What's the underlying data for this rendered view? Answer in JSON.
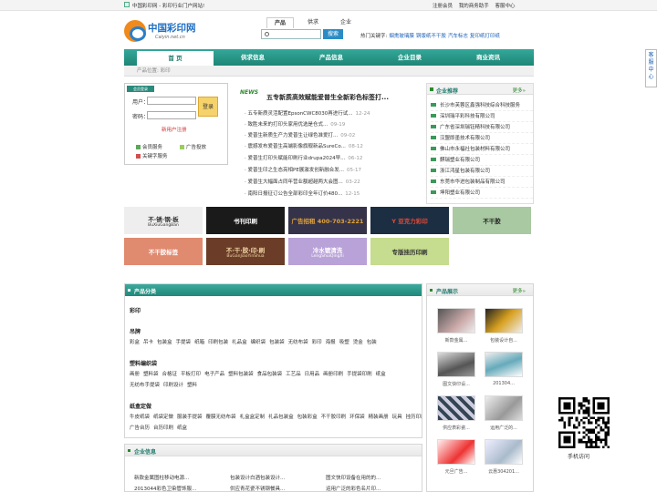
{
  "topbar": {
    "site_text": "中国彩印网 - 彩印行业门户网站!",
    "links": [
      "注册会员",
      "我的商务助手",
      "客服中心"
    ]
  },
  "logo": {
    "cn": "中国彩印网",
    "url": "Caiyin.net.cn"
  },
  "search": {
    "tabs": [
      "产品",
      "供求",
      "企业"
    ],
    "active_tab": "产品",
    "placeholder": "",
    "button": "搜索",
    "hot_label": "热门关键字:",
    "hot_keywords": [
      "烟熏玻璃膜",
      "铜版纸不干胶",
      "汽车标志",
      "复印纸打印纸"
    ]
  },
  "nav": {
    "items": [
      "首 页",
      "供求信息",
      "产品信息",
      "企业目录",
      "商业资讯"
    ],
    "active": "首 页"
  },
  "breadcrumb": "产品位置: 彩印",
  "login": {
    "badge": "会员登录",
    "user_label": "用户：",
    "pass_label": "密码：",
    "login_button": "登录",
    "register": "新用户注册",
    "services": [
      "会员服务",
      "广告投放",
      "关键字服务"
    ]
  },
  "news": {
    "badge": "NEWS",
    "headline": "五专新质高效赋能爱普生全新彩色标签打...",
    "items": [
      {
        "title": "五专新质灵活配置EpsonCWC8030再进行试...",
        "date": "12-24"
      },
      {
        "title": "致胜未来的打印头家用优选是仓式...",
        "date": "09-19"
      },
      {
        "title": "爱普生新质生产力爱普生让绿色准爱打...",
        "date": "09-02"
      },
      {
        "title": "震撼发布爱普生高端影像旗舰新品SureCo...",
        "date": "08-12"
      },
      {
        "title": "爱普生打印头赋能印刷行业drupa2024早...",
        "date": "06-12"
      },
      {
        "title": "爱普生印之生态亮相PE展激发创新融合发...",
        "date": "05-17"
      },
      {
        "title": "爱普生大幅面占同年营业额超越两大会图...",
        "date": "03-22"
      },
      {
        "title": "南阳日报征订公告全部彩印全年订价480...",
        "date": "12-15"
      }
    ]
  },
  "recommend": {
    "title": "企业推荐",
    "more": "更多»",
    "items": [
      "长沙市芙蓉区鑫强科技综合科技服务",
      "深圳瑞平彩科技有限公司",
      "广东省深圳瑞钰精科技有限公司",
      "汉盟即墨技术有限公司",
      "佛山市永福社包装材料有限公司",
      "麒瑞塑业有限公司",
      "浙江鸿星包装有限公司",
      "东莞市华进包装制品有限公司",
      "坤阳塑业有限公司"
    ]
  },
  "ads": [
    {
      "text": "不·锈·钢·板\nBuXiuGangBan",
      "bg": "#eeeeee",
      "fg": "#333333"
    },
    {
      "text": "书刊印刷",
      "bg": "#1a1a1a",
      "fg": "#ffffff"
    },
    {
      "text": "广告招租 400-703-2221",
      "bg": "#35334a",
      "fg": "#e2a33a"
    },
    {
      "text": "Y 亚克力彩印",
      "bg": "#1b2e42",
      "fg": "#e04a3a"
    },
    {
      "text": "不干胶",
      "bg": "#a9c9a2",
      "fg": "#222222"
    },
    {
      "text": "不干胶标签",
      "bg": "#e08a70",
      "fg": "#ffffff"
    },
    {
      "text": "不·干·胶·印·刷\nBuGanJiaoYinShua",
      "bg": "#6b3d28",
      "fg": "#f3d8a6"
    },
    {
      "text": "冷水镀清洗\nLengShuiQingXi",
      "bg": "#b9a2d8",
      "fg": "#ffffff"
    },
    {
      "text": "专版挂历印刷",
      "bg": "#c6dc8e",
      "fg": "#333333"
    }
  ],
  "categories": {
    "title": "产品分类",
    "groups": [
      {
        "name": "彩印",
        "items": []
      },
      {
        "name": "吊牌",
        "items": [
          "彩盒",
          "吊卡",
          "包装盒",
          "手提袋",
          "纸箱",
          "印刷包装",
          "礼品盒",
          "编织袋",
          "包装袋",
          "无纺布袋",
          "彩印",
          "海报",
          "吸塑",
          "烫金",
          "包装"
        ]
      },
      {
        "name": "塑料编织袋",
        "items": [
          "画册",
          "塑料袋",
          "合格证",
          "平板打印",
          "电子产品",
          "塑料包装袋",
          "食品包装袋",
          "工艺品",
          "日用品",
          "画册印刷",
          "手提袋印刷",
          "纸盒",
          "无纺布手提袋",
          "印刷设计",
          "塑料"
        ]
      },
      {
        "name": "纸盒定做",
        "items": [
          "牛皮纸袋",
          "纸袋定做",
          "服装手提袋",
          "覆膜无纺布袋",
          "礼盒盒定制",
          "礼品包装盒",
          "包装彩盒",
          "不干胶印刷",
          "环保袋",
          "精装画册",
          "玩具",
          "挂历印刷",
          "广告台历",
          "台历印刷",
          "纸盒"
        ]
      }
    ]
  },
  "products": {
    "title": "产品展示",
    "more": "更多»",
    "items": [
      "新款金属...",
      "包装设计自...",
      "图文快印设...",
      "201304...",
      "供应表彩瓷...",
      "运用广泛的...",
      "元旦广告...",
      "云惠304201..."
    ]
  },
  "business": {
    "title": "企业信息",
    "rows": [
      [
        "新款金属图柱移动电源...",
        "包装设计白酒包装设计...",
        "图文快印设备在用的的..."
      ],
      [
        "2013044彩色卫染管饰服...",
        "供应青花瓷不锈钢餐具...",
        "运用广泛的彩色名片印..."
      ]
    ]
  },
  "side_help": "客服中心",
  "qr_caption": "手机访问",
  "colors": {
    "nav": "#22877a",
    "accent": "#2a8a2a",
    "link": "#1a5fb4"
  }
}
